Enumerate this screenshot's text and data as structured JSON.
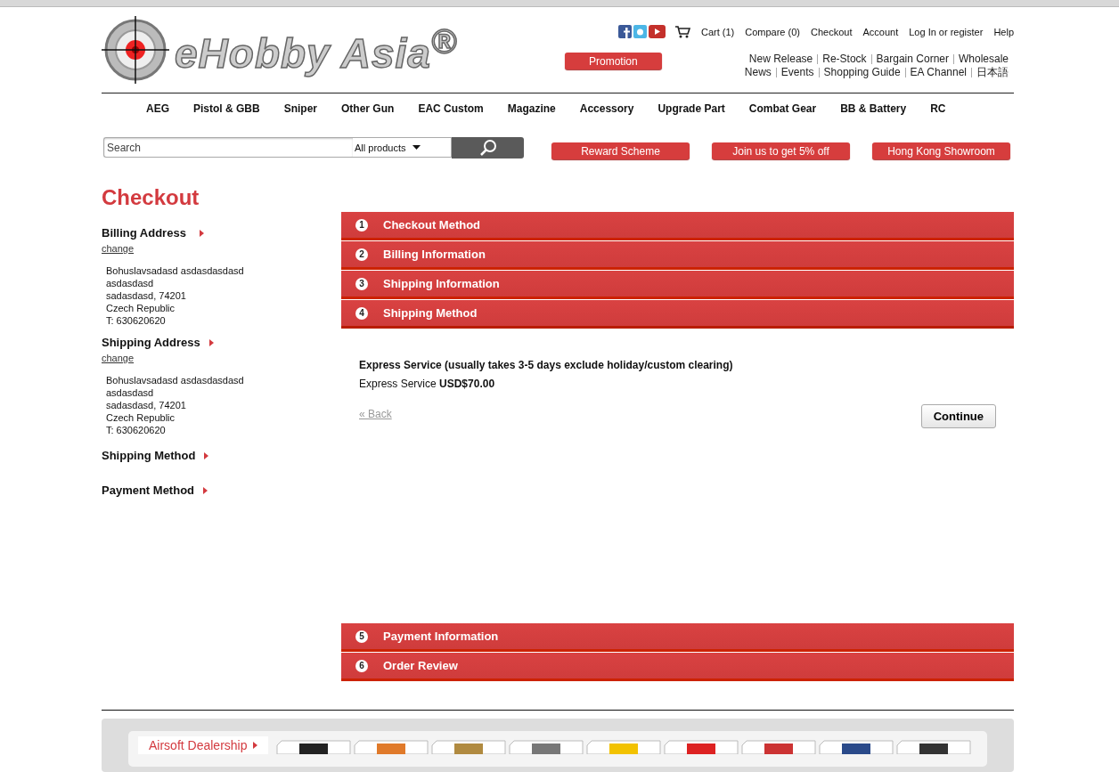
{
  "logo": {
    "text": "eHobby Asia$^{®}$"
  },
  "header_links": [
    "Cart (1)",
    "Compare (0)",
    "Checkout",
    "Account",
    "Log In or register",
    "Help"
  ],
  "promotion": "Promotion",
  "quick_links": [
    [
      "New Release",
      "Re-Stock",
      "Bargain Corner",
      "Wholesale"
    ],
    [
      "News",
      "Events",
      "Shopping Guide",
      "EA Channel",
      "日本語"
    ]
  ],
  "main_menu": [
    "AEG",
    "Pistol & GBB",
    "Sniper",
    "Other Gun",
    "EAC Custom",
    "Magazine",
    "Accessory",
    "Upgrade Part",
    "Combat Gear",
    "BB & Battery",
    "RC"
  ],
  "search": {
    "placeholder": "Search",
    "scope": "All products"
  },
  "red_buttons": [
    "Reward Scheme",
    "Join us to get 5% off",
    "Hong Kong Showroom"
  ],
  "page_title": "Checkout",
  "progress": [
    {
      "title": "Billing Address",
      "link": "change",
      "lines": [
        "Bohuslavsadasd asdasdasdasd",
        "asdasdasd",
        "sadasdasd, 74201",
        "Czech Republic",
        "T: 630620620"
      ]
    },
    {
      "title": "Shipping Address",
      "link": "change",
      "lines": [
        "Bohuslavsadasd asdasdasdasd",
        "asdasdasd",
        "sadasdasd, 74201",
        "Czech Republic",
        "T: 630620620"
      ]
    },
    {
      "title": "Shipping Method"
    },
    {
      "title": "Payment Method"
    }
  ],
  "steps": [
    {
      "number": "1",
      "title": "Checkout Method",
      "expanded": false
    },
    {
      "number": "2",
      "title": "Billing Information",
      "expanded": false
    },
    {
      "number": "3",
      "title": "Shipping Information",
      "expanded": false
    },
    {
      "number": "4",
      "title": "Shipping Method",
      "expanded": true
    },
    {
      "number": "5",
      "title": "Payment Information",
      "expanded": false
    },
    {
      "number": "6",
      "title": "Order Review",
      "expanded": false
    }
  ],
  "shipping_panel": {
    "heading": "Express Service (usually takes 3-5 days exclude holiday/custom clearing)",
    "option": "Express Service **USD$70.00**",
    "back": "« Back",
    "continue": "Continue"
  },
  "footer": {
    "dealership": "Airsoft Dealership"
  }
}
